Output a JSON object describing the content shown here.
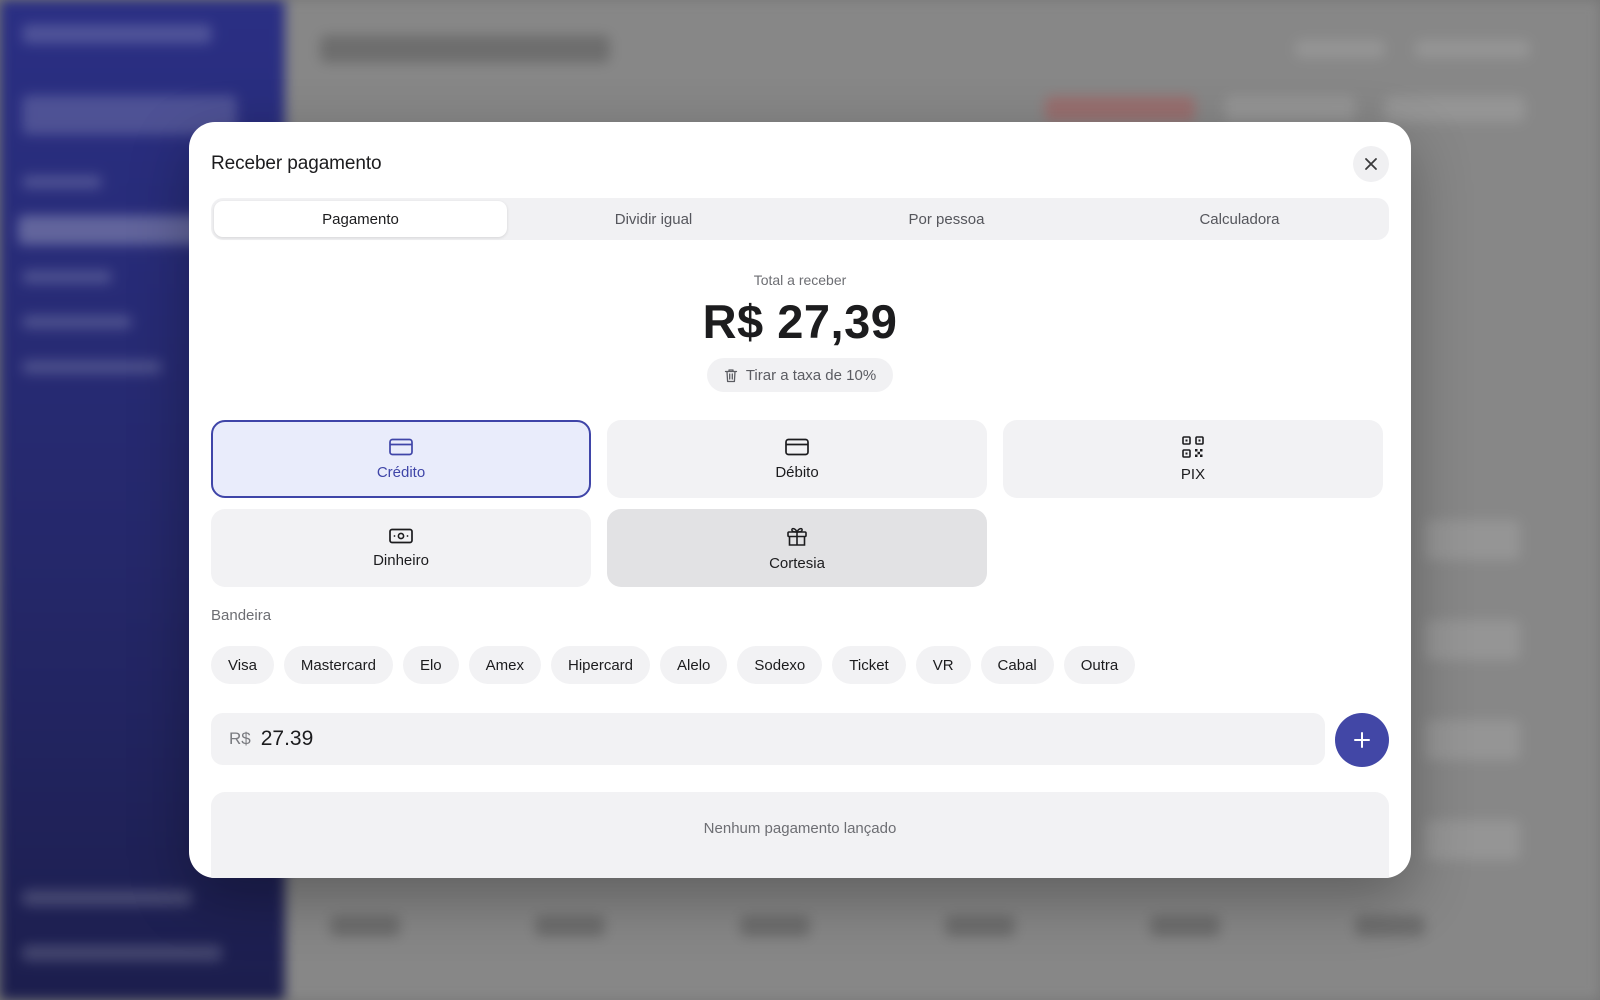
{
  "modal": {
    "title": "Receber pagamento",
    "close_icon": "close-icon"
  },
  "tabs": [
    {
      "label": "Pagamento",
      "active": true
    },
    {
      "label": "Dividir igual",
      "active": false
    },
    {
      "label": "Por pessoa",
      "active": false
    },
    {
      "label": "Calculadora",
      "active": false
    }
  ],
  "total": {
    "label": "Total a receber",
    "value": "R$ 27,39",
    "fee_button": "Tirar a taxa de 10%",
    "fee_icon": "trash-icon"
  },
  "methods": [
    {
      "label": "Crédito",
      "icon": "credit-card-icon",
      "selected": true
    },
    {
      "label": "Débito",
      "icon": "debit-card-icon",
      "selected": false
    },
    {
      "label": "PIX",
      "icon": "qr-code-icon",
      "selected": false
    },
    {
      "label": "Dinheiro",
      "icon": "cash-icon",
      "selected": false
    },
    {
      "label": "Cortesia",
      "icon": "gift-icon",
      "selected": false
    }
  ],
  "brand": {
    "label": "Bandeira",
    "options": [
      "Visa",
      "Mastercard",
      "Elo",
      "Amex",
      "Hipercard",
      "Alelo",
      "Sodexo",
      "Ticket",
      "VR",
      "Cabal",
      "Outra"
    ]
  },
  "amount": {
    "prefix": "R$",
    "value": "27.39",
    "add_icon": "plus-icon"
  },
  "payments": {
    "empty_text": "Nenhum pagamento lançado"
  },
  "colors": {
    "accent": "#4247a6",
    "selected_bg": "#e9ecfb",
    "sidebar": "#2b3087"
  }
}
